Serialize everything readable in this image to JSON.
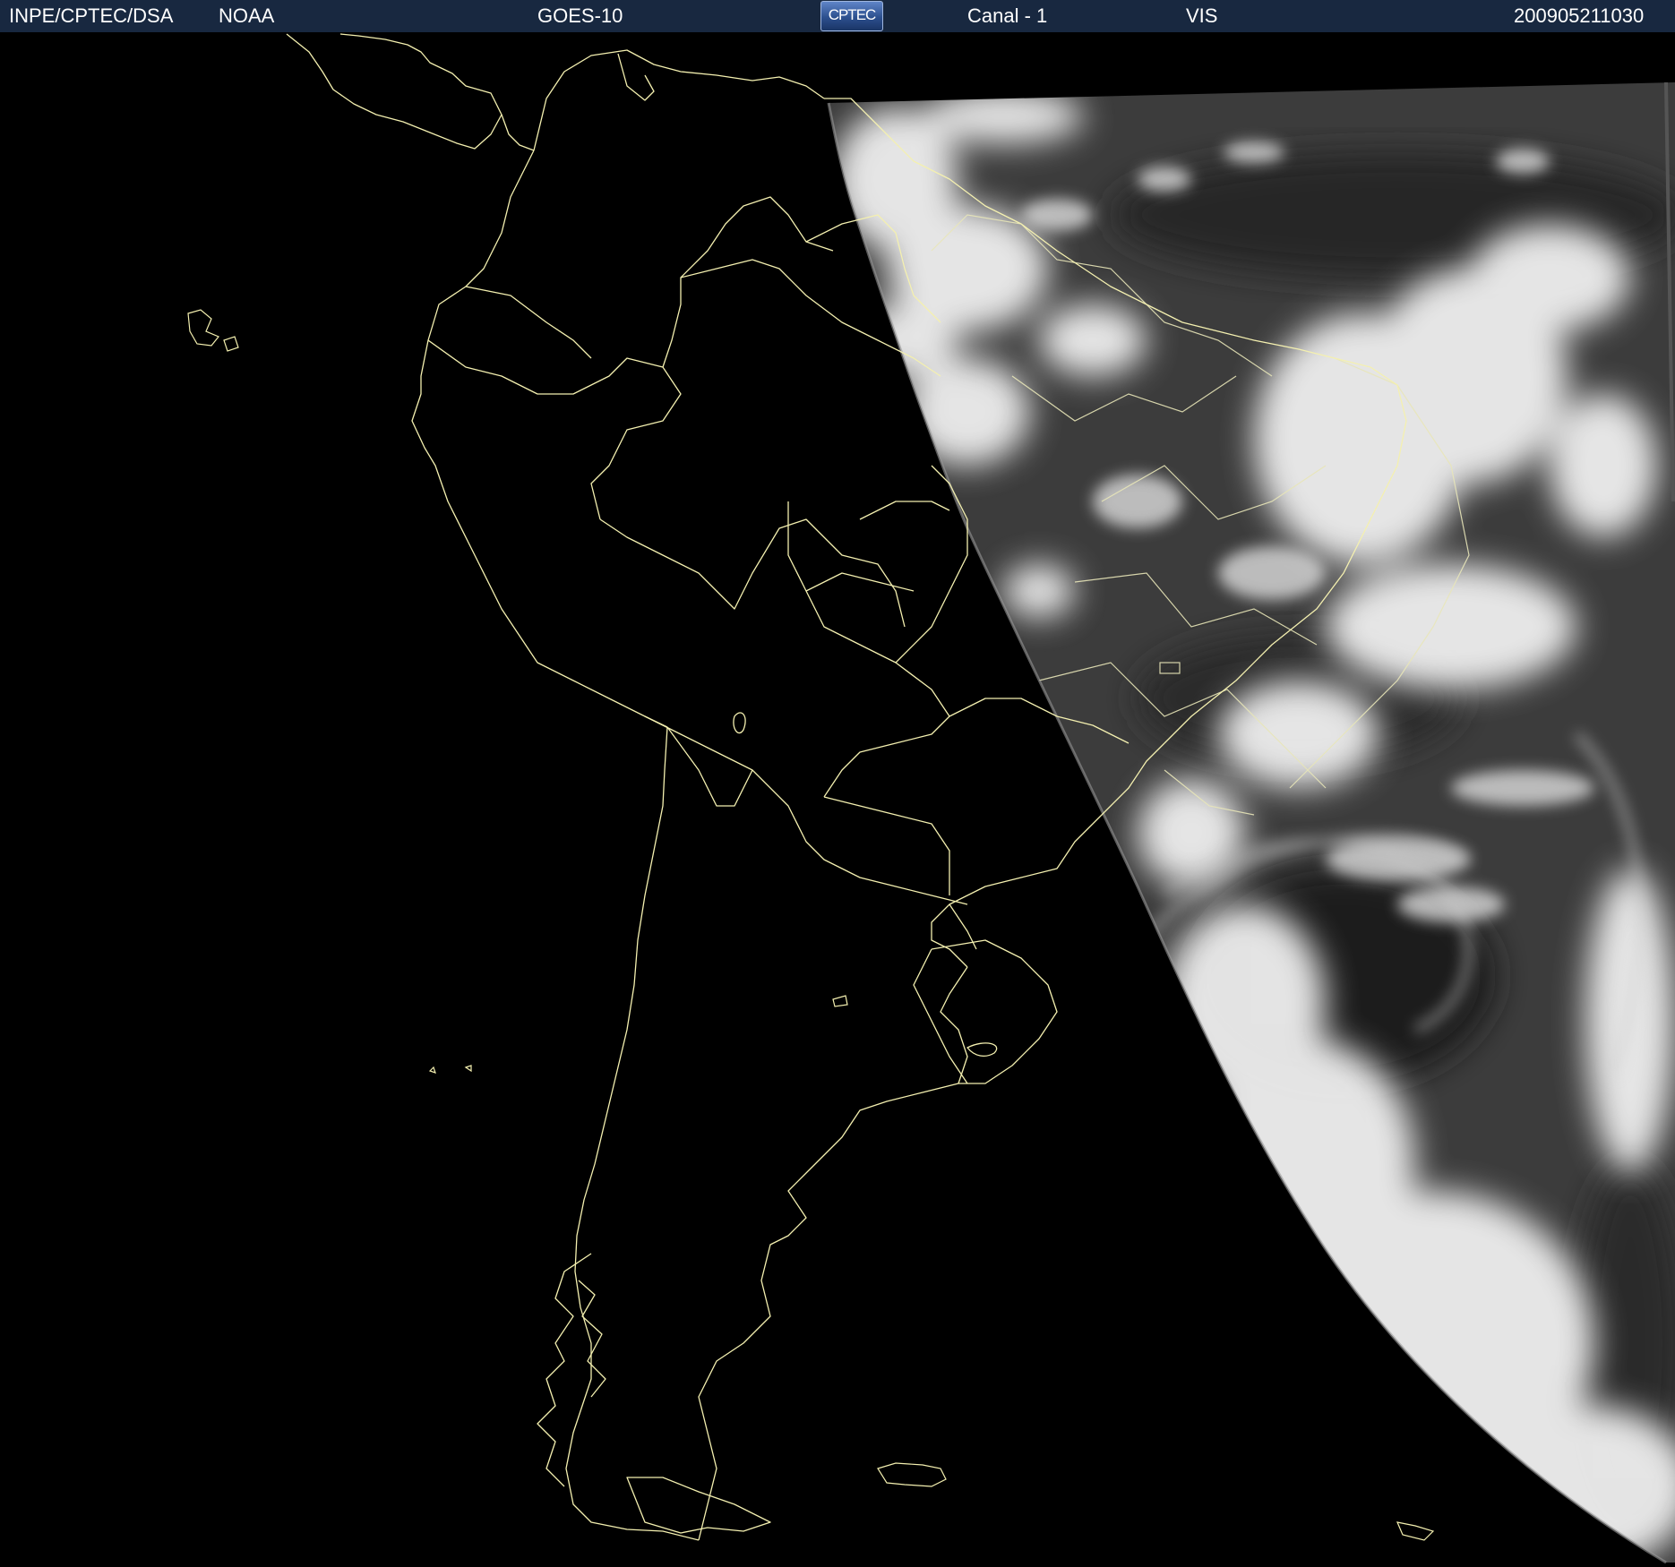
{
  "header": {
    "institution": "INPE/CPTEC/DSA",
    "agency": "NOAA",
    "satellite": "GOES-10",
    "logo_text": "CPTEC",
    "channel": "Canal - 1",
    "band": "VIS",
    "timestamp": "200905211030"
  },
  "map": {
    "image_type": "satellite-visible-imagery",
    "region": "South America",
    "coastline_color": "#f4f0b0",
    "night_color": "#000000",
    "cloud_color": "#f0f0f0"
  }
}
